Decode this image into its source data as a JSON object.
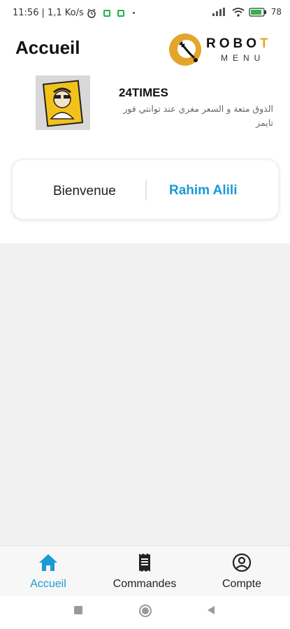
{
  "status_bar": {
    "time": "11:56",
    "network_speed": "| 1,1 Ko/s",
    "battery": "78"
  },
  "header": {
    "title": "Accueil",
    "logo_word1_main": "ROBO",
    "logo_word1_accent": "T",
    "logo_word2": "MENU"
  },
  "restaurant": {
    "name": "24TIMES",
    "description": "الذوق متعة و السعر مغري عند توانتي فور تايمز"
  },
  "welcome": {
    "label": "Bienvenue",
    "user": "Rahim Alili"
  },
  "bottom_nav": {
    "items": [
      {
        "label": "Accueil",
        "icon": "home-icon",
        "active": true
      },
      {
        "label": "Commandes",
        "icon": "receipt-icon",
        "active": false
      },
      {
        "label": "Compte",
        "icon": "account-icon",
        "active": false
      }
    ]
  },
  "colors": {
    "accent": "#1a9ad6",
    "logo_gold": "#e3a52a"
  }
}
